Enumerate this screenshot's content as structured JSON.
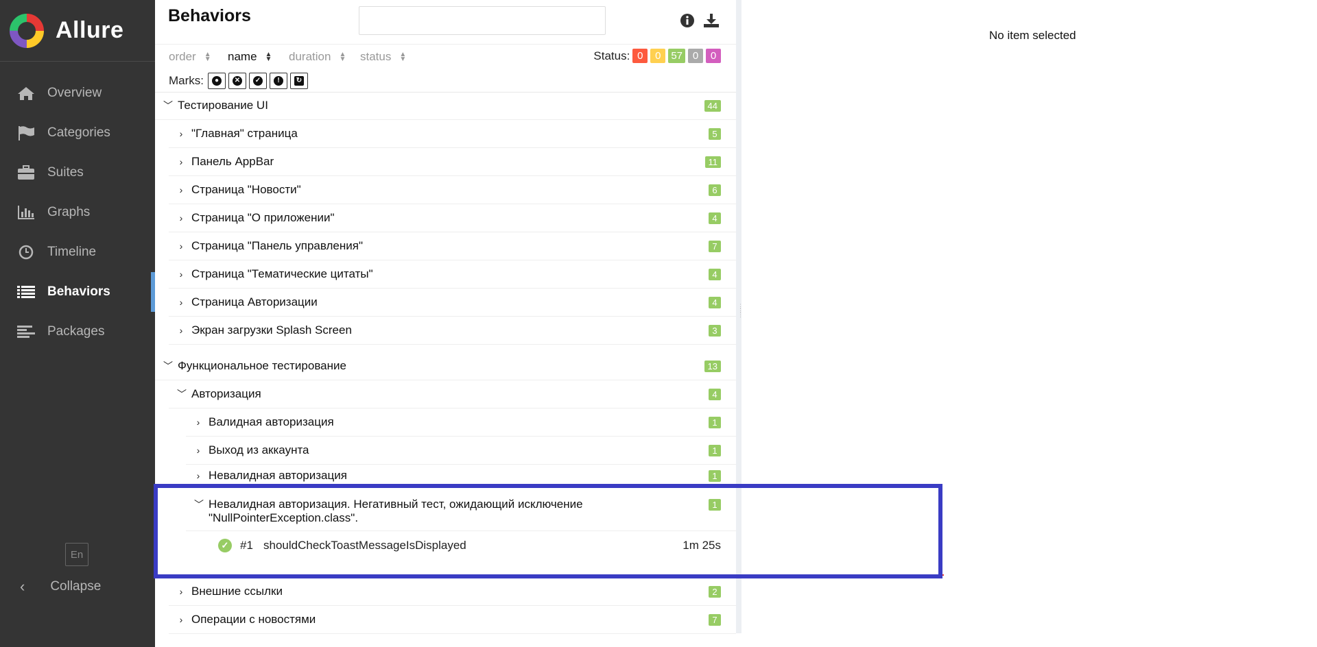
{
  "app": {
    "name": "Allure"
  },
  "sidebar": {
    "items": [
      {
        "label": "Overview",
        "icon": "home-icon"
      },
      {
        "label": "Categories",
        "icon": "flag-icon"
      },
      {
        "label": "Suites",
        "icon": "briefcase-icon"
      },
      {
        "label": "Graphs",
        "icon": "bar-chart-icon"
      },
      {
        "label": "Timeline",
        "icon": "clock-icon"
      },
      {
        "label": "Behaviors",
        "icon": "list-icon",
        "active": true
      },
      {
        "label": "Packages",
        "icon": "align-left-icon"
      }
    ],
    "language": "En",
    "collapse_label": "Collapse"
  },
  "pane": {
    "title": "Behaviors",
    "search_placeholder": "",
    "sort": {
      "order": "order",
      "name": "name",
      "duration": "duration",
      "status": "status"
    },
    "status_label": "Status:",
    "status_counts": {
      "failed": "0",
      "broken": "0",
      "passed": "57",
      "skipped": "0",
      "unknown": "0"
    },
    "marks_label": "Marks:"
  },
  "tree": {
    "group1": {
      "label": "Тестирование UI",
      "count": "44",
      "children": [
        {
          "label": "\"Главная\" страница",
          "count": "5"
        },
        {
          "label": "Панель AppBar",
          "count": "11"
        },
        {
          "label": "Страница \"Новости\"",
          "count": "6"
        },
        {
          "label": "Страница \"О приложении\"",
          "count": "4"
        },
        {
          "label": "Страница \"Панель управления\"",
          "count": "7"
        },
        {
          "label": "Страница \"Тематические цитаты\"",
          "count": "4"
        },
        {
          "label": "Страница Авторизации",
          "count": "4"
        },
        {
          "label": "Экран загрузки Splash Screen",
          "count": "3"
        }
      ]
    },
    "group2": {
      "label": "Функциональное тестирование",
      "count": "13",
      "auth": {
        "label": "Авторизация",
        "count": "4",
        "children": [
          {
            "label": "Валидная авторизация",
            "count": "1"
          },
          {
            "label": "Выход из аккаунта",
            "count": "1"
          },
          {
            "label": "Невалидная авторизация",
            "count": "1"
          }
        ],
        "expanded": {
          "label_line1": "Невалидная авторизация. Негативный тест, ожидающий исключение",
          "label_line2": "\"NullPointerException.class\".",
          "count": "1",
          "test": {
            "num": "#1",
            "name": "shouldCheckToastMessageIsDisplayed",
            "duration": "1m 25s"
          }
        }
      },
      "others": [
        {
          "label": "Внешние ссылки",
          "count": "2"
        },
        {
          "label": "Операции с новостями",
          "count": "7"
        }
      ]
    }
  },
  "detail": {
    "empty_text": "No item selected"
  },
  "colors": {
    "sidebar_bg": "#343434",
    "passed": "#97cc64",
    "failed": "#fd5a3e",
    "broken": "#ffd050",
    "skipped": "#aaaaaa",
    "unknown": "#d35ebe",
    "highlight": "#3a3cc4"
  }
}
